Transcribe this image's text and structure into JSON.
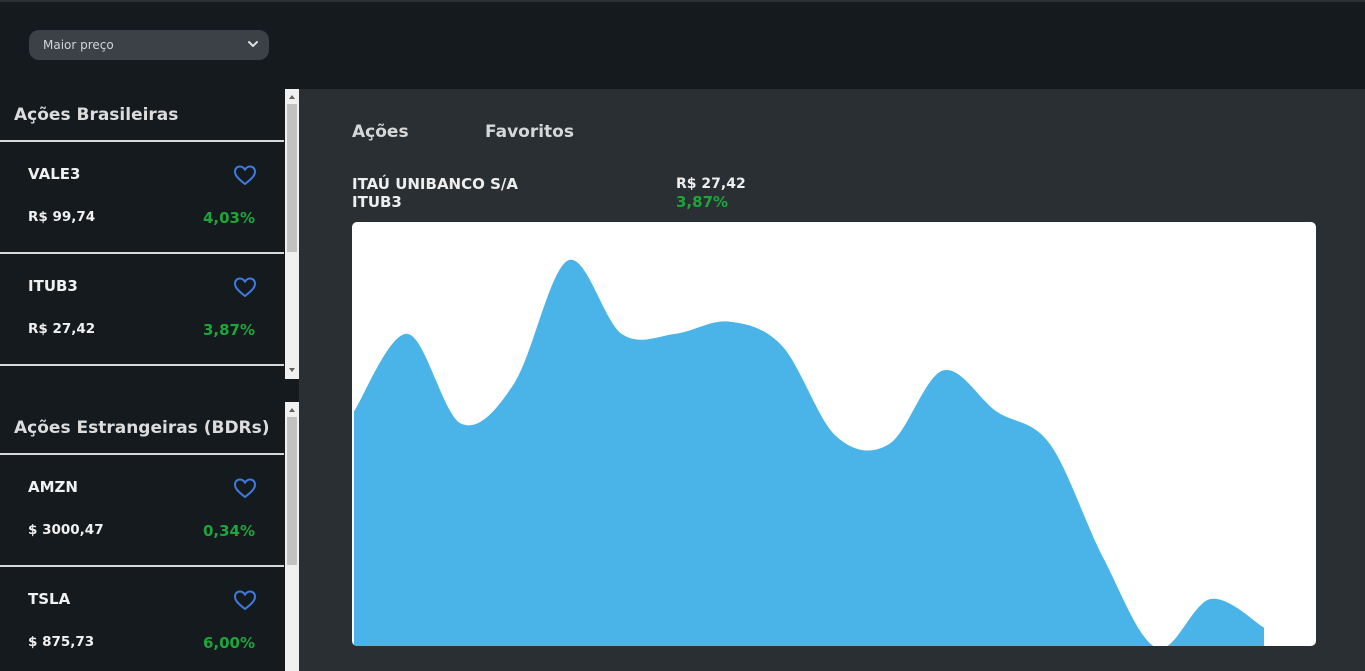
{
  "sort": {
    "selected": "Maior preço"
  },
  "brazil": {
    "title": "Ações Brasileiras",
    "items": [
      {
        "ticker": "VALE3",
        "price": "R$ 99,74",
        "change": "4,03%"
      },
      {
        "ticker": "ITUB3",
        "price": "R$ 27,42",
        "change": "3,87%"
      }
    ]
  },
  "foreign": {
    "title": "Ações Estrangeiras (BDRs)",
    "items": [
      {
        "ticker": "AMZN",
        "price": "$ 3000,47",
        "change": "0,34%"
      },
      {
        "ticker": "TSLA",
        "price": "$ 875,73",
        "change": "6,00%"
      }
    ]
  },
  "tabs": {
    "acoes": "Ações",
    "favoritos": "Favoritos"
  },
  "selected": {
    "company": "ITAÚ UNIBANCO S/A",
    "ticker": "ITUB3",
    "price": "R$ 27,42",
    "change": "3,87%"
  },
  "colors": {
    "positive": "#1ea53a",
    "accent": "#4ab3e8",
    "heart": "#3d7be0"
  },
  "icons": {
    "favorite": "heart-outline-icon",
    "dropdown": "chevron-down-icon"
  },
  "chart_data": {
    "type": "area",
    "title": "",
    "xlabel": "",
    "ylabel": "",
    "grid": false,
    "legend": "none",
    "values": [
      58,
      77,
      55,
      65,
      95,
      77,
      77,
      80,
      74,
      52,
      50,
      68,
      58,
      50,
      22,
      0,
      12,
      5
    ],
    "ylim": [
      0,
      100
    ]
  }
}
